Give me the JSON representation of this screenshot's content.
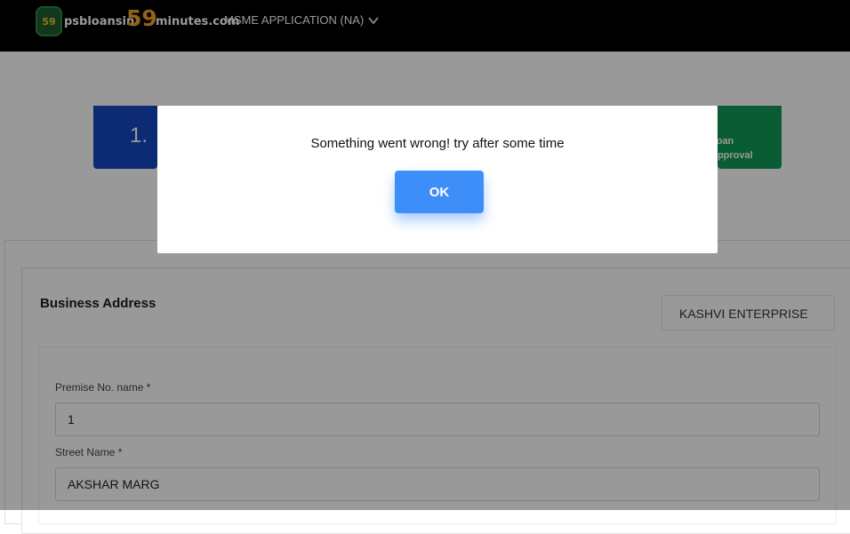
{
  "header": {
    "logo_number": "59",
    "logo_prefix": "psbloansin",
    "logo_big_number": "59",
    "logo_suffix": "minutes.com",
    "app_menu_label": "MSME APPLICATION (NA)"
  },
  "stepper": {
    "step1_label": "1.",
    "last_step_line1": "Loan",
    "last_step_line2": "Approval"
  },
  "form": {
    "section_title": "Business Address",
    "company_name": "KASHVI ENTERPRISE",
    "fields": [
      {
        "label": "Premise No. name *",
        "value": "1"
      },
      {
        "label": "Street Name *",
        "value": "AKSHAR MARG"
      }
    ]
  },
  "dialog": {
    "message": "Something went wrong! try after some time",
    "ok_label": "OK"
  },
  "colors": {
    "accent": "#3d8ef8",
    "step1": "#1746c2",
    "step_last": "#0f9a55"
  }
}
